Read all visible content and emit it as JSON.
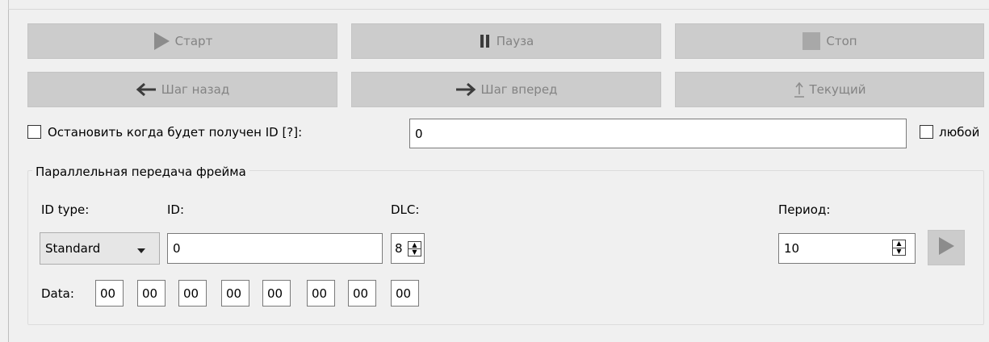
{
  "controls": {
    "start_label": "Старт",
    "pause_label": "Пауза",
    "stop_label": "Стоп",
    "step_back_label": "Шаг назад",
    "step_forward_label": "Шаг вперед",
    "current_label": "Текущий"
  },
  "stop_on_id": {
    "label": "Остановить когда будет получен ID [?]:",
    "value": "0",
    "any_label": "любой",
    "checked": false,
    "any_checked": false
  },
  "parallel_frame": {
    "title": "Параллельная передача фрейма",
    "id_type_label": "ID type:",
    "id_type_value": "Standard",
    "id_label": "ID:",
    "id_value": "0",
    "dlc_label": "DLC:",
    "dlc_value": "8",
    "period_label": "Период:",
    "period_value": "10",
    "data_label": "Data:",
    "data_bytes": [
      "00",
      "00",
      "00",
      "00",
      "00",
      "00",
      "00",
      "00"
    ]
  },
  "icons": {
    "start": "play-icon",
    "pause": "pause-icon",
    "stop": "stop-icon",
    "step_back": "arrow-left-icon",
    "step_forward": "arrow-right-icon",
    "current": "arrow-up-icon",
    "send": "play-icon"
  },
  "colors": {
    "button_bg": "#cccccc",
    "button_text": "#838383",
    "icon_gray": "#8c8c8c",
    "window_bg": "#f0f0f0"
  }
}
